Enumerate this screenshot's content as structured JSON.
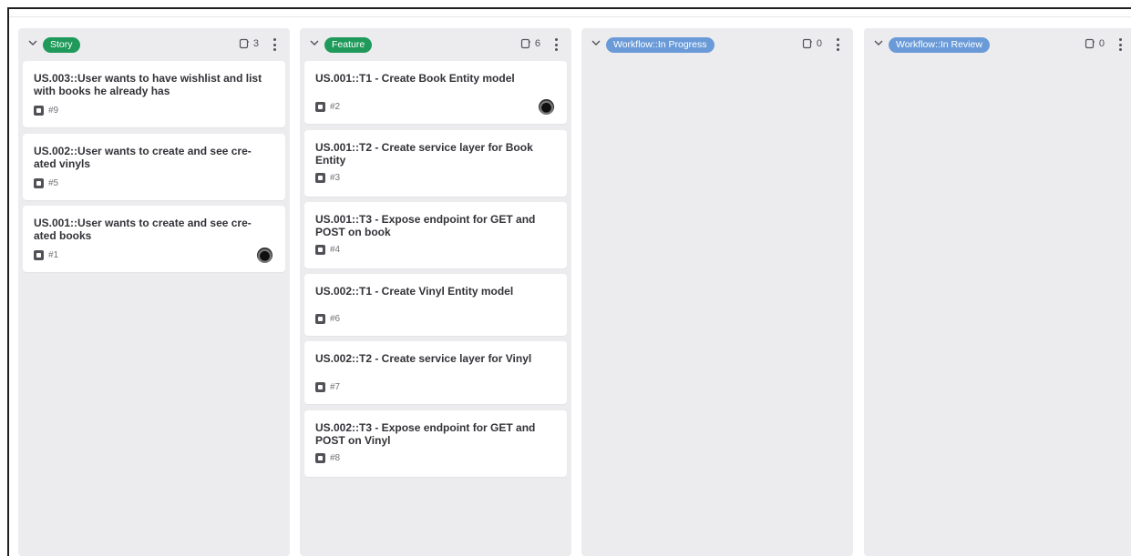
{
  "colors": {
    "story_label": "#1f9a5a",
    "feature_label": "#1f9a5a",
    "workflow_label": "#6a9bd8",
    "column_bg": "#ececef"
  },
  "columns": [
    {
      "label": "Story",
      "count": "3",
      "cards": [
        {
          "title": "US.003::User wants to have wishlist and list with books he already has",
          "ref": "#9",
          "avatar": false
        },
        {
          "title": "US.002::User wants to create and see cre-ated vinyls",
          "ref": "#5",
          "avatar": false
        },
        {
          "title": "US.001::User wants to create and see cre-ated books",
          "ref": "#1",
          "avatar": true
        }
      ]
    },
    {
      "label": "Feature",
      "count": "6",
      "cards": [
        {
          "title": "US.001::T1 - Create Book Entity model",
          "ref": "#2",
          "avatar": true
        },
        {
          "title": "US.001::T2 - Create service layer for Book Entity",
          "ref": "#3",
          "avatar": false
        },
        {
          "title": "US.001::T3 - Expose endpoint for GET and POST on book",
          "ref": "#4",
          "avatar": false
        },
        {
          "title": "US.002::T1 - Create Vinyl Entity model",
          "ref": "#6",
          "avatar": false
        },
        {
          "title": "US.002::T2 - Create service layer for Vinyl",
          "ref": "#7",
          "avatar": false
        },
        {
          "title": "US.002::T3 - Expose endpoint for GET and POST on Vinyl",
          "ref": "#8",
          "avatar": false
        }
      ]
    },
    {
      "label": "Workflow::In Progress",
      "count": "0",
      "cards": []
    },
    {
      "label": "Workflow::In Review",
      "count": "0",
      "cards": []
    }
  ]
}
